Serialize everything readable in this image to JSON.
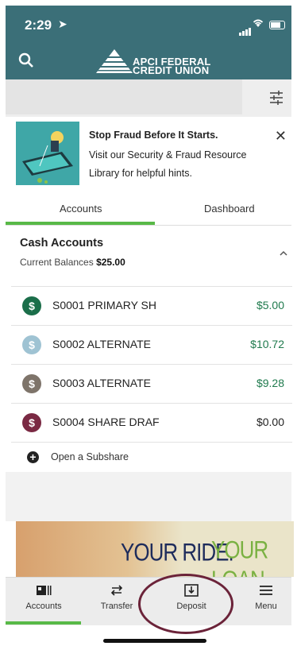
{
  "status_bar": {
    "time": "2:29",
    "location_glyph": "➤"
  },
  "header": {
    "logo_line1": "APCI FEDERAL",
    "logo_line2": "CREDIT UNION"
  },
  "banner": {
    "title": "Stop Fraud Before It Starts.",
    "line2": "Visit our Security & Fraud Resource",
    "line3": "Library for helpful hints.",
    "close": "✕"
  },
  "tabs": [
    {
      "label": "Accounts",
      "active": true
    },
    {
      "label": "Dashboard",
      "active": false
    }
  ],
  "cash": {
    "title": "Cash Accounts",
    "balance_label": "Current Balances",
    "balance_value": "$25.00"
  },
  "accounts": [
    {
      "name": "S0001 PRIMARY SH",
      "amount": "$5.00",
      "coin_color": "#1b6e4a",
      "amount_color": "#1f7a4d"
    },
    {
      "name": "S0002 ALTERNATE",
      "amount": "$10.72",
      "coin_color": "#9fc3d3",
      "amount_color": "#1f7a4d"
    },
    {
      "name": "S0003 ALTERNATE",
      "amount": "$9.28",
      "coin_color": "#7e746a",
      "amount_color": "#1f7a4d"
    },
    {
      "name": "S0004 SHARE DRAF",
      "amount": "$0.00",
      "coin_color": "#7a2943",
      "amount_color": "#222222"
    }
  ],
  "coin_symbol": "$",
  "open_subshare": {
    "label": "Open a Subshare",
    "icon": "+"
  },
  "promo": {
    "part1": "YOUR RIDE.",
    "part2": "YOUR LOAN."
  },
  "bottom_nav": [
    {
      "label": "Accounts",
      "icon": "accounts-icon"
    },
    {
      "label": "Transfer",
      "icon": "transfer-icon"
    },
    {
      "label": "Deposit",
      "icon": "deposit-icon"
    },
    {
      "label": "Menu",
      "icon": "menu-icon"
    }
  ],
  "colors": {
    "header": "#3b6f78",
    "accent_green": "#58b947",
    "highlight_oval": "#6b2339"
  }
}
